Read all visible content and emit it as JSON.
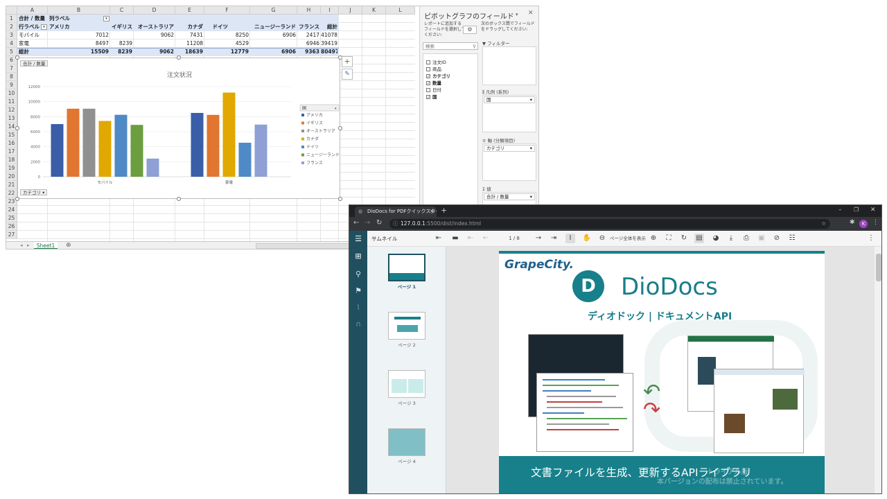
{
  "excel": {
    "columns": [
      "A",
      "B",
      "C",
      "D",
      "E",
      "F",
      "G",
      "H",
      "I",
      "J",
      "K",
      "L"
    ],
    "rows": [
      "1",
      "2",
      "3",
      "4",
      "5",
      "6",
      "7",
      "8",
      "9",
      "10",
      "11",
      "12",
      "13",
      "14",
      "15",
      "16",
      "17",
      "18",
      "19",
      "20",
      "21",
      "22",
      "23",
      "24",
      "25",
      "26",
      "27"
    ],
    "pivot": {
      "r1": {
        "a": "合計 / 数量",
        "b": "列ラベル"
      },
      "r2": {
        "a": "行ラベル",
        "b": "アメリカ",
        "c": "イギリス",
        "d": "オーストラリア",
        "e": "カナダ",
        "f": "ドイツ",
        "g": "ニュージーランド",
        "h": "フランス",
        "i": "総計"
      },
      "r3": {
        "a": "モバイル",
        "b": "7012",
        "d": "9062",
        "e": "7431",
        "f": "8250",
        "g": "6906",
        "h": "2417",
        "i": "41078"
      },
      "r4": {
        "a": "家電",
        "b": "8497",
        "c": "8239",
        "e": "11208",
        "f": "4529",
        "h": "6946",
        "i": "39419"
      },
      "r5": {
        "a": "総計",
        "b": "15509",
        "c": "8239",
        "d": "9062",
        "e": "18639",
        "f": "12779",
        "g": "6906",
        "h": "9363",
        "i": "80497"
      }
    },
    "chart_field_button": "合計 / 数量",
    "axis_field_button": "カテゴリ",
    "sheet_tab": "Sheet1",
    "add_sheet": "⊕"
  },
  "chart_data": {
    "type": "bar",
    "title": "注文状況",
    "categories": [
      "モバイル",
      "家電"
    ],
    "ylim": [
      0,
      12000
    ],
    "yticks": [
      "12000",
      "10000",
      "8000",
      "6000",
      "4000",
      "2000",
      "0"
    ],
    "legend_title": "国",
    "legend_position": "right",
    "series": [
      {
        "name": "アメリカ",
        "values": [
          7012,
          8497
        ],
        "color": "#3a5ea8"
      },
      {
        "name": "イギリス",
        "values": [
          9062,
          8239
        ],
        "color": "#e07630"
      },
      {
        "name": "オーストラリア",
        "values": [
          9062,
          0
        ],
        "color": "#909090"
      },
      {
        "name": "カナダ",
        "values": [
          7431,
          11208
        ],
        "color": "#e0a800"
      },
      {
        "name": "ドイツ",
        "values": [
          8250,
          4529
        ],
        "color": "#4f8ac6"
      },
      {
        "name": "ニュージーランド",
        "values": [
          6906,
          0
        ],
        "color": "#6a9e3e"
      },
      {
        "name": "フランス",
        "values": [
          2417,
          6946
        ],
        "color": "#8ea0d6"
      }
    ]
  },
  "pane": {
    "title": "ピボットグラフのフィールド",
    "instruction_left": "レポートに追加するフィールドを選択してください:",
    "instruction_right": "次のボックス間でフィールドをドラッグしてください:",
    "search_placeholder": "検索",
    "fields": [
      {
        "label": "注文ID",
        "checked": false
      },
      {
        "label": "商品",
        "checked": false
      },
      {
        "label": "カテゴリ",
        "checked": true
      },
      {
        "label": "数量",
        "checked": true
      },
      {
        "label": "日付",
        "checked": false
      },
      {
        "label": "国",
        "checked": true
      }
    ],
    "filter_label": "フィルター",
    "legend_label": "凡例 (系列)",
    "legend_value": "国",
    "axis_label": "軸 (分類項目)",
    "axis_value": "カテゴリ",
    "values_label": "値",
    "values_value": "合計 / 数量",
    "check_mark": "✓"
  },
  "chrome": {
    "tab_title": "DioDocs for PDFクイックスタート | P",
    "url_host": "127.0.0.1",
    "url_rest": ":5500/dist/index.html",
    "profile_initial": "K",
    "sidebar_title": "サムネイル",
    "page_indicator": "1 / 8",
    "zoom_label": "ページ全体を表示",
    "thumbnails": [
      "ページ 1",
      "ページ 2",
      "ページ 3",
      "ページ 4"
    ],
    "doc": {
      "brand": "GrapeCity.",
      "product": "DioDocs",
      "subtitle": "ディオドック | ドキュメントAPI",
      "banner": "文書ファイルを生成、更新するAPIライブラリ",
      "watermark1": "トライアル版",
      "watermark2": "本バージョンの配布は禁止されています。"
    }
  }
}
